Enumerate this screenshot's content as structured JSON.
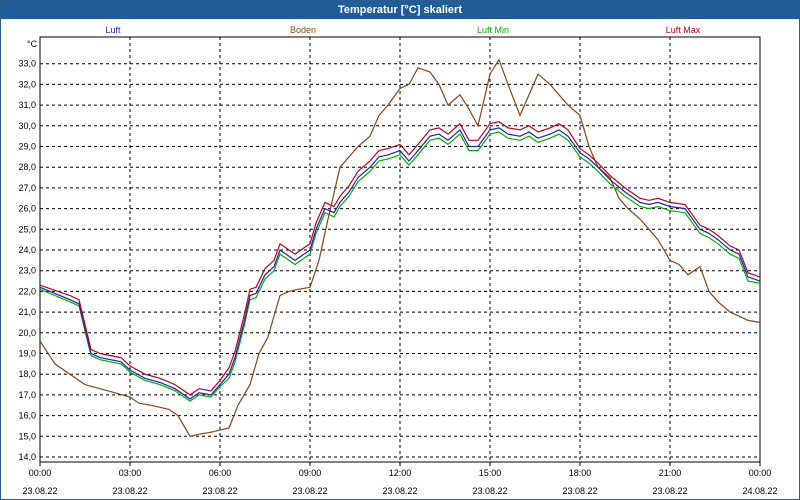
{
  "window": {
    "title": "Temperatur [°C] skaliert"
  },
  "chart_data": {
    "type": "line",
    "title": "Temperatur [°C] skaliert",
    "ylabel": "°C",
    "ylim": [
      14.0,
      34.0
    ],
    "yticks": [
      "14,0",
      "15,0",
      "16,0",
      "17,0",
      "18,0",
      "19,0",
      "20,0",
      "21,0",
      "22,0",
      "23,0",
      "24,0",
      "25,0",
      "26,0",
      "27,0",
      "28,0",
      "29,0",
      "30,0",
      "31,0",
      "32,0",
      "33,0"
    ],
    "xlim": [
      0,
      24
    ],
    "xticks": [
      {
        "time": "00:00",
        "date": "23.08.22"
      },
      {
        "time": "03:00",
        "date": "23.08.22"
      },
      {
        "time": "06:00",
        "date": "23.08.22"
      },
      {
        "time": "09:00",
        "date": "23.08.22"
      },
      {
        "time": "12:00",
        "date": "23.08.22"
      },
      {
        "time": "15:00",
        "date": "23.08.22"
      },
      {
        "time": "18:00",
        "date": "23.08.22"
      },
      {
        "time": "21:00",
        "date": "23.08.22"
      },
      {
        "time": "00:00",
        "date": "24.08.22"
      }
    ],
    "grid": true,
    "legend_position": "top",
    "series": [
      {
        "name": "Luft",
        "color": "#2020c0",
        "x": [
          0,
          1,
          1.3,
          1.7,
          2,
          2.7,
          3,
          3.5,
          4,
          4.5,
          5,
          5.3,
          5.7,
          6,
          6.3,
          6.5,
          6.8,
          7,
          7.2,
          7.5,
          7.8,
          8,
          8.2,
          8.5,
          8.8,
          9,
          9.2,
          9.5,
          9.8,
          10,
          10.3,
          10.6,
          11,
          11.3,
          11.6,
          12,
          12.3,
          12.6,
          13,
          13.3,
          13.6,
          14,
          14.3,
          14.6,
          15,
          15.3,
          15.6,
          16,
          16.3,
          16.6,
          17,
          17.3,
          17.6,
          18,
          18.3,
          18.6,
          19,
          19.5,
          20,
          20.3,
          20.6,
          21,
          21.5,
          22,
          22.3,
          22.6,
          23,
          23.3,
          23.6,
          24
        ],
        "y": [
          22.2,
          21.6,
          21.4,
          19.0,
          18.8,
          18.6,
          18.2,
          17.8,
          17.6,
          17.3,
          16.8,
          17.1,
          17.0,
          17.5,
          18.0,
          18.8,
          20.5,
          21.8,
          21.9,
          22.8,
          23.2,
          24.0,
          23.8,
          23.5,
          23.8,
          24.0,
          25.0,
          26.0,
          25.8,
          26.3,
          26.8,
          27.5,
          28.0,
          28.5,
          28.6,
          28.8,
          28.3,
          28.8,
          29.5,
          29.6,
          29.3,
          29.8,
          29.0,
          29.0,
          29.8,
          29.9,
          29.6,
          29.5,
          29.7,
          29.4,
          29.6,
          29.8,
          29.5,
          28.7,
          28.4,
          28.0,
          27.4,
          26.8,
          26.3,
          26.2,
          26.3,
          26.1,
          26.0,
          25.0,
          24.8,
          24.5,
          24.0,
          23.8,
          22.7,
          22.5
        ]
      },
      {
        "name": "Boden",
        "color": "#8b4513",
        "x": [
          0,
          0.5,
          1,
          1.5,
          2,
          2.5,
          3,
          3.3,
          3.7,
          4,
          4.3,
          4.6,
          5,
          5.3,
          5.7,
          6,
          6.3,
          6.6,
          7,
          7.3,
          7.6,
          8,
          8.3,
          8.6,
          9,
          9.3,
          9.6,
          10,
          10.3,
          10.6,
          11,
          11.3,
          11.6,
          12,
          12.3,
          12.6,
          13,
          13.3,
          13.6,
          14,
          14.3,
          14.6,
          15,
          15.3,
          15.6,
          16,
          16.3,
          16.6,
          17,
          17.3,
          17.6,
          18,
          18.3,
          18.6,
          19,
          19.3,
          19.6,
          20,
          20.3,
          20.6,
          21,
          21.3,
          21.6,
          22,
          22.3,
          22.6,
          23,
          23.3,
          23.6,
          24
        ],
        "y": [
          19.6,
          18.5,
          18.0,
          17.5,
          17.3,
          17.1,
          16.9,
          16.6,
          16.5,
          16.4,
          16.3,
          16.0,
          15.0,
          15.1,
          15.2,
          15.3,
          15.4,
          16.5,
          17.5,
          19.0,
          19.8,
          21.8,
          22.0,
          22.1,
          22.2,
          23.5,
          25.5,
          28.0,
          28.5,
          29.0,
          29.5,
          30.5,
          31.0,
          31.8,
          32.0,
          32.8,
          32.6,
          32.0,
          31.0,
          31.5,
          30.8,
          30.0,
          32.5,
          33.2,
          32.0,
          30.5,
          31.5,
          32.5,
          32.0,
          31.5,
          31.0,
          30.5,
          29.0,
          28.0,
          27.5,
          26.5,
          26.0,
          25.5,
          25.0,
          24.5,
          23.5,
          23.3,
          22.8,
          23.2,
          22.0,
          21.5,
          21.0,
          20.8,
          20.6,
          20.5
        ]
      },
      {
        "name": "Luft Min",
        "color": "#00b000",
        "x": [
          0,
          1,
          1.3,
          1.7,
          2,
          2.7,
          3,
          3.5,
          4,
          4.5,
          5,
          5.3,
          5.7,
          6,
          6.3,
          6.5,
          6.8,
          7,
          7.2,
          7.5,
          7.8,
          8,
          8.2,
          8.5,
          8.8,
          9,
          9.2,
          9.5,
          9.8,
          10,
          10.3,
          10.6,
          11,
          11.3,
          11.6,
          12,
          12.3,
          12.6,
          13,
          13.3,
          13.6,
          14,
          14.3,
          14.6,
          15,
          15.3,
          15.6,
          16,
          16.3,
          16.6,
          17,
          17.3,
          17.6,
          18,
          18.3,
          18.6,
          19,
          19.5,
          20,
          20.3,
          20.6,
          21,
          21.5,
          22,
          22.3,
          22.6,
          23,
          23.3,
          23.6,
          24
        ],
        "y": [
          22.1,
          21.5,
          21.3,
          18.9,
          18.7,
          18.5,
          18.1,
          17.7,
          17.5,
          17.2,
          16.7,
          17.0,
          16.9,
          17.4,
          17.8,
          18.6,
          20.3,
          21.6,
          21.7,
          22.6,
          23.0,
          23.8,
          23.6,
          23.3,
          23.6,
          23.8,
          24.8,
          25.8,
          25.6,
          26.1,
          26.6,
          27.3,
          27.8,
          28.3,
          28.4,
          28.6,
          28.1,
          28.6,
          29.3,
          29.4,
          29.1,
          29.6,
          28.8,
          28.8,
          29.6,
          29.7,
          29.4,
          29.3,
          29.5,
          29.2,
          29.4,
          29.6,
          29.3,
          28.5,
          28.2,
          27.8,
          27.2,
          26.6,
          26.1,
          26.0,
          26.1,
          25.9,
          25.8,
          24.8,
          24.6,
          24.3,
          23.8,
          23.6,
          22.5,
          22.4
        ]
      },
      {
        "name": "Luft Max",
        "color": "#c00020",
        "x": [
          0,
          1,
          1.3,
          1.7,
          2,
          2.7,
          3,
          3.5,
          4,
          4.5,
          5,
          5.3,
          5.7,
          6,
          6.3,
          6.5,
          6.8,
          7,
          7.2,
          7.5,
          7.8,
          8,
          8.2,
          8.5,
          8.8,
          9,
          9.2,
          9.5,
          9.8,
          10,
          10.3,
          10.6,
          11,
          11.3,
          11.6,
          12,
          12.3,
          12.6,
          13,
          13.3,
          13.6,
          14,
          14.3,
          14.6,
          15,
          15.3,
          15.6,
          16,
          16.3,
          16.6,
          17,
          17.3,
          17.6,
          18,
          18.3,
          18.6,
          19,
          19.5,
          20,
          20.3,
          20.6,
          21,
          21.5,
          22,
          22.3,
          22.6,
          23,
          23.3,
          23.6,
          24
        ],
        "y": [
          22.3,
          21.8,
          21.6,
          19.2,
          19.0,
          18.8,
          18.4,
          18.0,
          17.8,
          17.5,
          17.0,
          17.3,
          17.2,
          17.7,
          18.3,
          19.1,
          20.8,
          22.1,
          22.2,
          23.1,
          23.5,
          24.3,
          24.1,
          23.8,
          24.1,
          24.3,
          25.3,
          26.3,
          26.1,
          26.6,
          27.1,
          27.8,
          28.3,
          28.8,
          28.9,
          29.1,
          28.6,
          29.1,
          29.8,
          29.9,
          29.6,
          30.1,
          29.3,
          29.3,
          30.1,
          30.2,
          29.9,
          29.8,
          30.0,
          29.7,
          29.9,
          30.1,
          29.8,
          28.9,
          28.6,
          28.2,
          27.6,
          27.0,
          26.5,
          26.4,
          26.5,
          26.3,
          26.2,
          25.2,
          25.0,
          24.7,
          24.2,
          24.0,
          22.9,
          22.7
        ]
      }
    ]
  }
}
